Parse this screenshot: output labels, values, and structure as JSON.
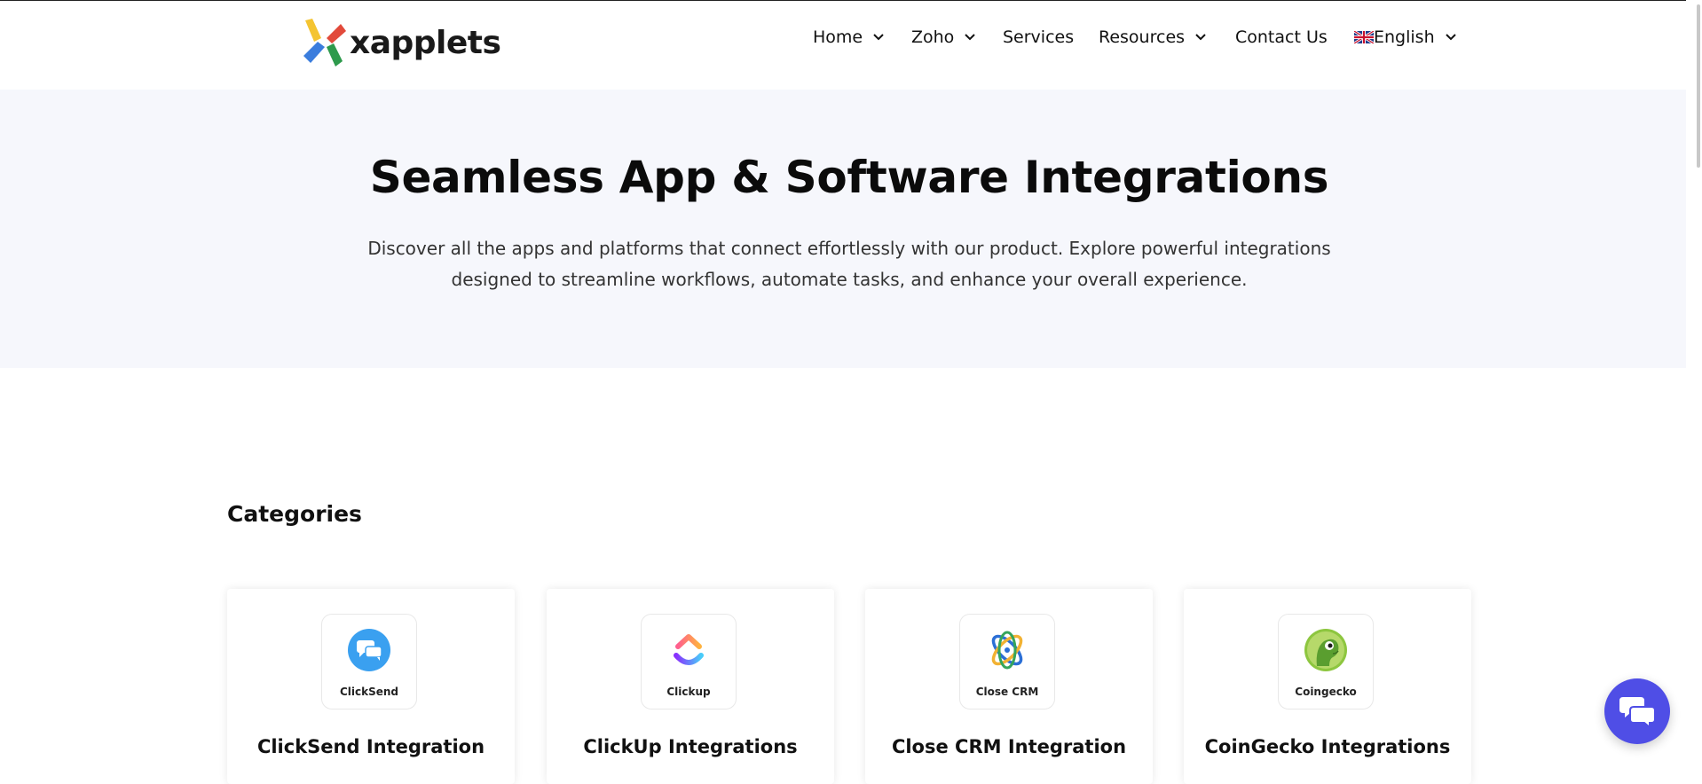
{
  "header": {
    "brand": "xapplets",
    "nav": [
      {
        "label": "Home",
        "has_dropdown": true
      },
      {
        "label": "Zoho",
        "has_dropdown": true
      },
      {
        "label": "Services",
        "has_dropdown": false
      },
      {
        "label": "Resources",
        "has_dropdown": true
      },
      {
        "label": "Contact Us",
        "has_dropdown": false
      },
      {
        "label": "English",
        "has_dropdown": true,
        "icon": "uk-flag-icon"
      }
    ]
  },
  "hero": {
    "title": "Seamless App & Software Integrations",
    "subtitle_line1": "Discover all the apps and platforms that connect effortlessly with our product. Explore powerful integrations",
    "subtitle_line2": "designed to streamline workflows, automate tasks, and enhance your overall experience."
  },
  "categories": {
    "heading": "Categories",
    "cards": [
      {
        "logo_label": "ClickSend",
        "title": "ClickSend Integration",
        "icon": "clicksend-icon"
      },
      {
        "logo_label": "Clickup",
        "title": "ClickUp Integrations",
        "icon": "clickup-icon"
      },
      {
        "logo_label": "Close CRM",
        "title": "Close CRM Integration",
        "icon": "close-crm-icon"
      },
      {
        "logo_label": "Coingecko",
        "title": "CoinGecko Integrations",
        "icon": "coingecko-icon"
      }
    ]
  },
  "chat": {
    "icon": "chat-bubbles-icon"
  },
  "colors": {
    "accent": "#4f4ee6",
    "hero_bg": "#f6f7fc"
  }
}
